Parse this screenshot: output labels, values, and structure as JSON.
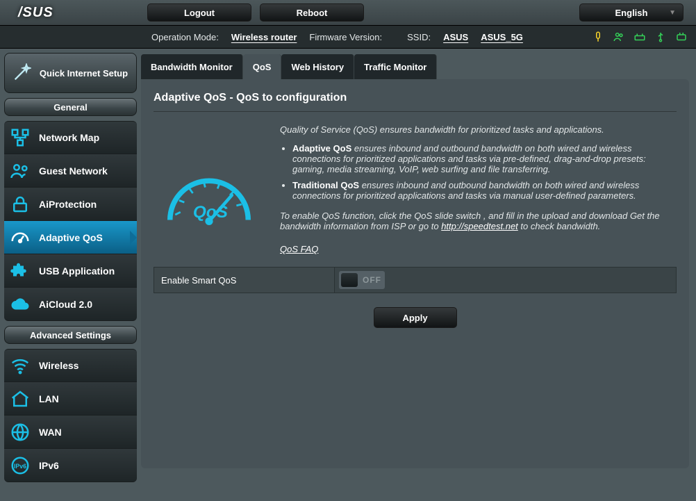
{
  "brand": "/SUS",
  "top_buttons": {
    "logout": "Logout",
    "reboot": "Reboot",
    "language": "English"
  },
  "info": {
    "op_mode_label": "Operation Mode:",
    "op_mode": "Wireless router",
    "fw_label": "Firmware Version:",
    "fw": "",
    "ssid_label": "SSID:",
    "ssid_a": "ASUS",
    "ssid_b": "ASUS_5G"
  },
  "quick_setup": "Quick Internet Setup",
  "sections": {
    "general": "General",
    "advanced": "Advanced Settings"
  },
  "nav_general": [
    {
      "id": "network-map",
      "label": "Network Map"
    },
    {
      "id": "guest-network",
      "label": "Guest Network"
    },
    {
      "id": "aiprotection",
      "label": "AiProtection"
    },
    {
      "id": "adaptive-qos",
      "label": "Adaptive QoS",
      "active": true
    },
    {
      "id": "usb-application",
      "label": "USB Application"
    },
    {
      "id": "aicloud",
      "label": "AiCloud 2.0"
    }
  ],
  "nav_advanced": [
    {
      "id": "wireless",
      "label": "Wireless"
    },
    {
      "id": "lan",
      "label": "LAN"
    },
    {
      "id": "wan",
      "label": "WAN"
    },
    {
      "id": "ipv6",
      "label": "IPv6"
    }
  ],
  "tabs": [
    {
      "id": "bandwidth-monitor",
      "label": "Bandwidth Monitor"
    },
    {
      "id": "qos",
      "label": "QoS",
      "active": true
    },
    {
      "id": "web-history",
      "label": "Web History"
    },
    {
      "id": "traffic-monitor",
      "label": "Traffic Monitor"
    }
  ],
  "page": {
    "title": "Adaptive QoS - QoS to configuration",
    "intro": "Quality of Service (QoS) ensures bandwidth for prioritized tasks and applications.",
    "bullet1_b": "Adaptive QoS",
    "bullet1": " ensures inbound and outbound bandwidth on both wired and wireless connections for prioritized applications and tasks via pre-defined, drag-and-drop presets: gaming, media streaming, VoIP, web surfing and file transferring.",
    "bullet2_b": "Traditional QoS",
    "bullet2": " ensures inbound and outbound bandwidth on both wired and wireless connections for prioritized applications and tasks via manual user-defined parameters.",
    "enable_pre": "To enable QoS function, click the QoS slide switch , and fill in the upload and download Get the bandwidth information from ISP or go to ",
    "speedtest": "http://speedtest.net",
    "enable_post": " to check bandwidth.",
    "faq": "QoS FAQ",
    "toggle_label": "Enable Smart QoS",
    "toggle_state": "OFF",
    "apply": "Apply",
    "gauge_text": "QoS"
  },
  "status_icons": [
    "lamp",
    "users",
    "router",
    "usb",
    "wifi"
  ]
}
